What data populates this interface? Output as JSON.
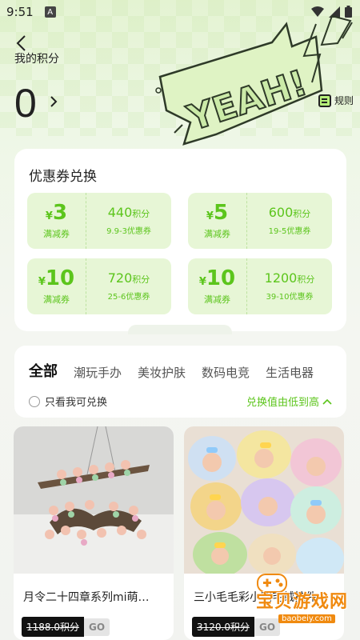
{
  "status": {
    "time": "9:51",
    "a_badge": "A"
  },
  "header": {
    "title": "我的积分",
    "points": "0",
    "rules_label": "规则"
  },
  "coupons": {
    "title": "优惠券兑换",
    "items": [
      {
        "yen": "¥",
        "value": "3",
        "type": "满减券",
        "points": "440",
        "unit": "积分",
        "desc": "9.9-3优惠券"
      },
      {
        "yen": "¥",
        "value": "5",
        "type": "满减券",
        "points": "600",
        "unit": "积分",
        "desc": "19-5优惠券"
      },
      {
        "yen": "¥",
        "value": "10",
        "type": "满减券",
        "points": "720",
        "unit": "积分",
        "desc": "25-6优惠券"
      },
      {
        "yen": "¥",
        "value": "10",
        "type": "满减券",
        "points": "1200",
        "unit": "积分",
        "desc": "39-10优惠券"
      }
    ]
  },
  "categories": {
    "items": [
      "全部",
      "潮玩手办",
      "美妆护肤",
      "数码电竞",
      "生活电器"
    ],
    "only_mine": "只看我可兑换",
    "sort": "兑换值由低到高"
  },
  "products": [
    {
      "name": "月令二十四章系列mi萌…",
      "price": "1188.0积分",
      "go": "GO"
    },
    {
      "name": "三小毛毛彩小鸭毛绒挂件",
      "price": "3120.0积分",
      "go": "GO"
    }
  ],
  "watermark": {
    "text": "宝贝游戏网",
    "url": "baobeiy.com"
  },
  "colors": {
    "accent": "#5cc51c",
    "accent_light": "#e7f6d6",
    "highlight": "#b6f07a"
  }
}
